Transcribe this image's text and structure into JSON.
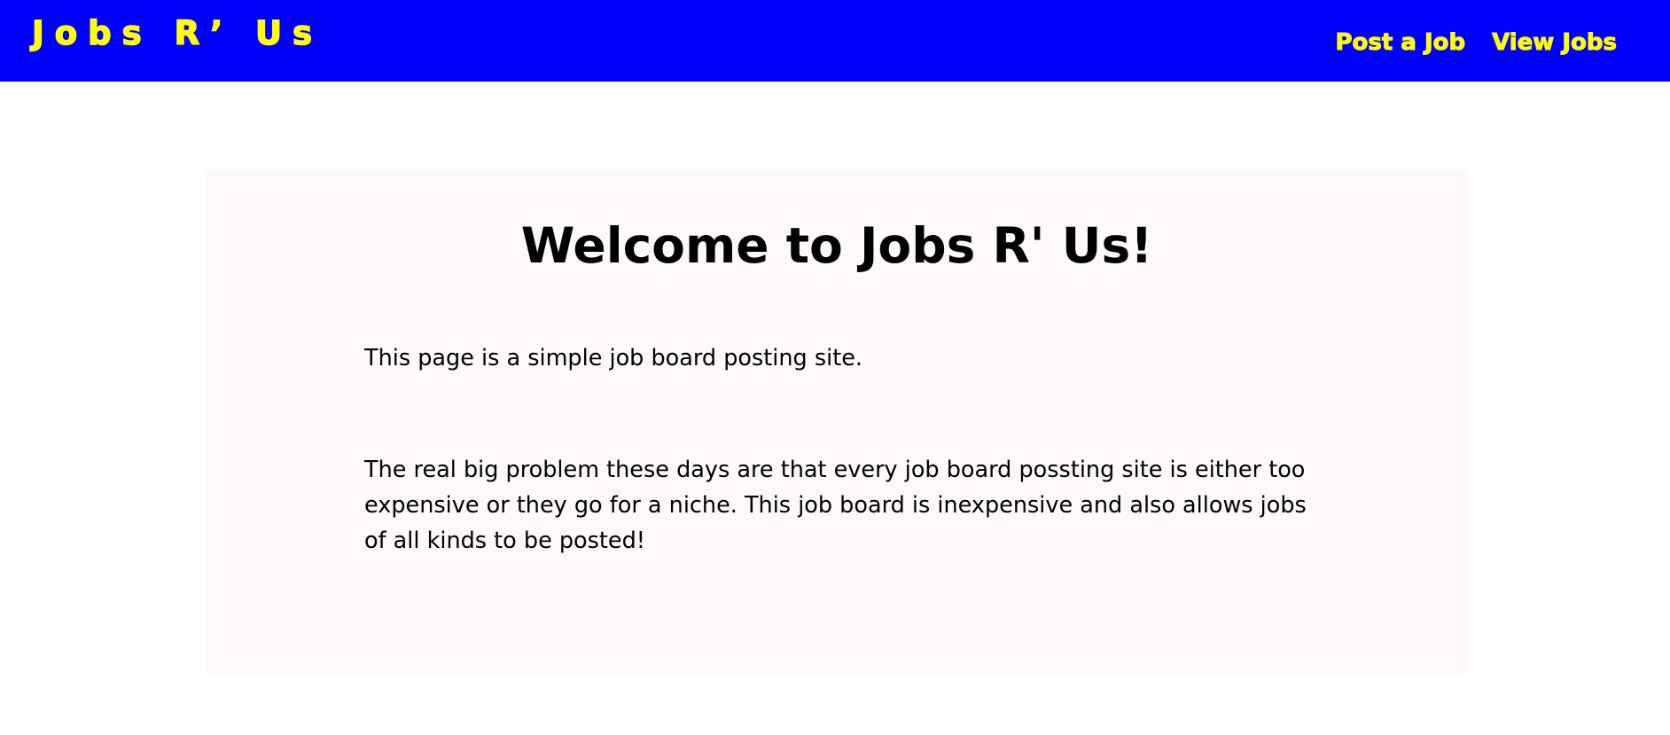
{
  "header": {
    "brand": "Jobs R’ Us",
    "nav": [
      {
        "label": "Post a Job"
      },
      {
        "label": "View Jobs"
      }
    ]
  },
  "main": {
    "title": "Welcome to Jobs R' Us!",
    "paragraphs": [
      "This page is a simple job board posting site.",
      "The real big problem these days are that every job board possting site is either too expensive or they go for a niche. This job board is inexpensive and also allows jobs of all kinds to be posted!"
    ]
  },
  "colors": {
    "header_bg": "#0000ff",
    "header_text": "#ffff00",
    "card_bg": "#fdf9fa",
    "body_text": "#000000"
  }
}
